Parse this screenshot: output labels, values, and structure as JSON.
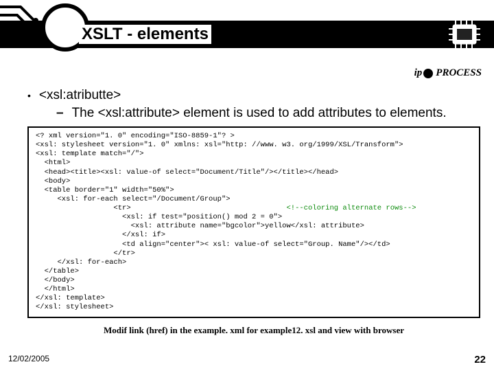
{
  "title": "XSLT - elements",
  "logo": "ipPROCESS",
  "bullet": "<xsl:atributte>",
  "sub": "The <xsl:attribute> element is used to add attributes to elements.",
  "code": {
    "l1": "<? xml version=\"1. 0\" encoding=\"ISO-8859-1\"? >",
    "l2": "<xsl: stylesheet version=\"1. 0\" xmlns: xsl=\"http: //www. w3. org/1999/XSL/Transform\">",
    "l3": "<xsl: template match=\"/\">",
    "l4": "  <html>",
    "l5": "  <head><title><xsl: value-of select=\"Document/Title\"/></title></head>",
    "l6": "  <body>",
    "l7": "  <table border=\"1\" width=\"50%\">",
    "l8": "     <xsl: for-each select=\"/Document/Group\">",
    "l9a": "                  <tr>                                    ",
    "l9b": "<!--coloring alternate rows-->",
    "l10": "                    <xsl: if test=\"position() mod 2 = 0\">",
    "l11": "                      <xsl: attribute name=\"bgcolor\">yellow</xsl: attribute>",
    "l12": "                    </xsl: if>",
    "l13": "                    <td align=\"center\">< xsl: value-of select=\"Group. Name\"/></td>",
    "l14": "                  </tr>",
    "l15": "     </xsl: for-each>",
    "l16": "  </table>",
    "l17": "  </body>",
    "l18": "  </html>",
    "l19": "</xsl: template>",
    "l20": "</xsl: stylesheet>"
  },
  "caption": "Modif link (href) in the example. xml for example12. xsl and view with browser",
  "footer_date": "12/02/2005",
  "footer_page": "22"
}
